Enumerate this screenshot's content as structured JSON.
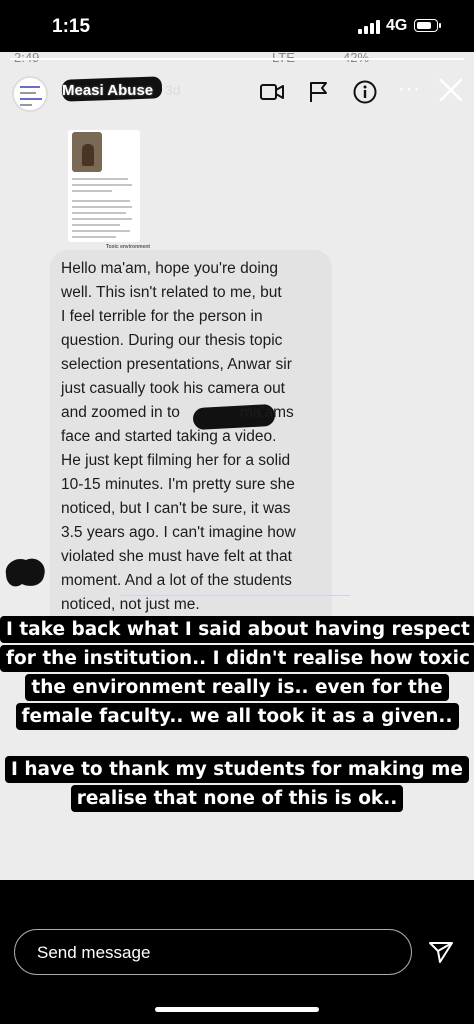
{
  "status_bar": {
    "time": "1:15",
    "network": "4G",
    "battery_level": 0.8
  },
  "inner_status": {
    "time": "2:49",
    "icons_text": "LTE",
    "battery": "42%"
  },
  "story": {
    "progress": 1.0,
    "username": "Measi Abuse",
    "time_ago": "3d",
    "icons": [
      "video-call-icon",
      "flag-icon",
      "info-icon",
      "more-icon",
      "close-icon"
    ]
  },
  "thumbnail": {
    "caption": "Toxic environment"
  },
  "message": {
    "lines": [
      "Hello ma'am, hope you're doing",
      "well. This isn't related to me, but",
      "I feel terrible for the person in",
      "question. During our thesis topic",
      "selection presentations, Anwar sir",
      "just casually took his camera out",
      "and zoomed in to",
      "ma'ams",
      "face and started taking a video.",
      "He just kept filming her for a solid",
      "10-15 minutes. I'm pretty sure she",
      "noticed, but I can't be sure, it was",
      "3.5 years ago. I can't imagine how",
      "violated she must have felt at that",
      "moment. And a lot of the students",
      "noticed, not just me."
    ]
  },
  "caption": {
    "lines": [
      "I take back what I said about having respect",
      "for the institution.. I didn't realise how toxic",
      "the environment really is.. even for the",
      "female faculty..  we all took it as a given.."
    ],
    "lines2": [
      "I have to thank my students for making me",
      "realise that none of this is ok.."
    ]
  },
  "reply": {
    "placeholder": "Send message"
  }
}
